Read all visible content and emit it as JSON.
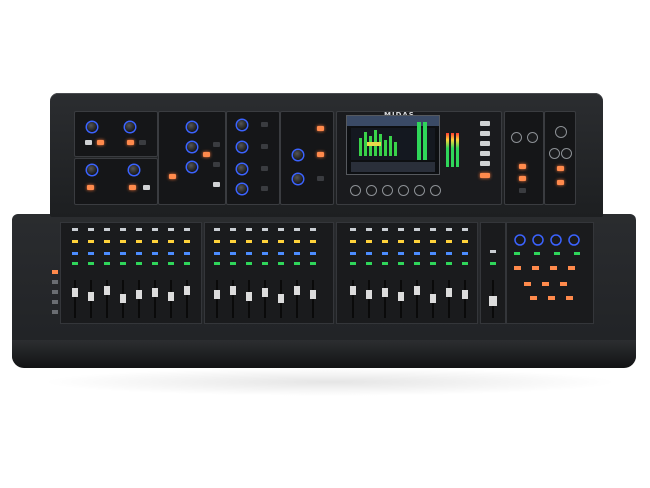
{
  "product": {
    "brand_logo_text": "MIDAS"
  },
  "colors": {
    "background": "#ffffff",
    "panel": "#1d1f21",
    "accent_blue": "#3b63ff",
    "accent_orange": "#ff8a4c",
    "led_green": "#2fd65a",
    "led_yellow": "#ffd23a",
    "led_red": "#ff3b2f"
  },
  "icons": {
    "knob": "rotary-knob-icon",
    "fader": "fader-icon",
    "screen": "display-screen-icon"
  }
}
